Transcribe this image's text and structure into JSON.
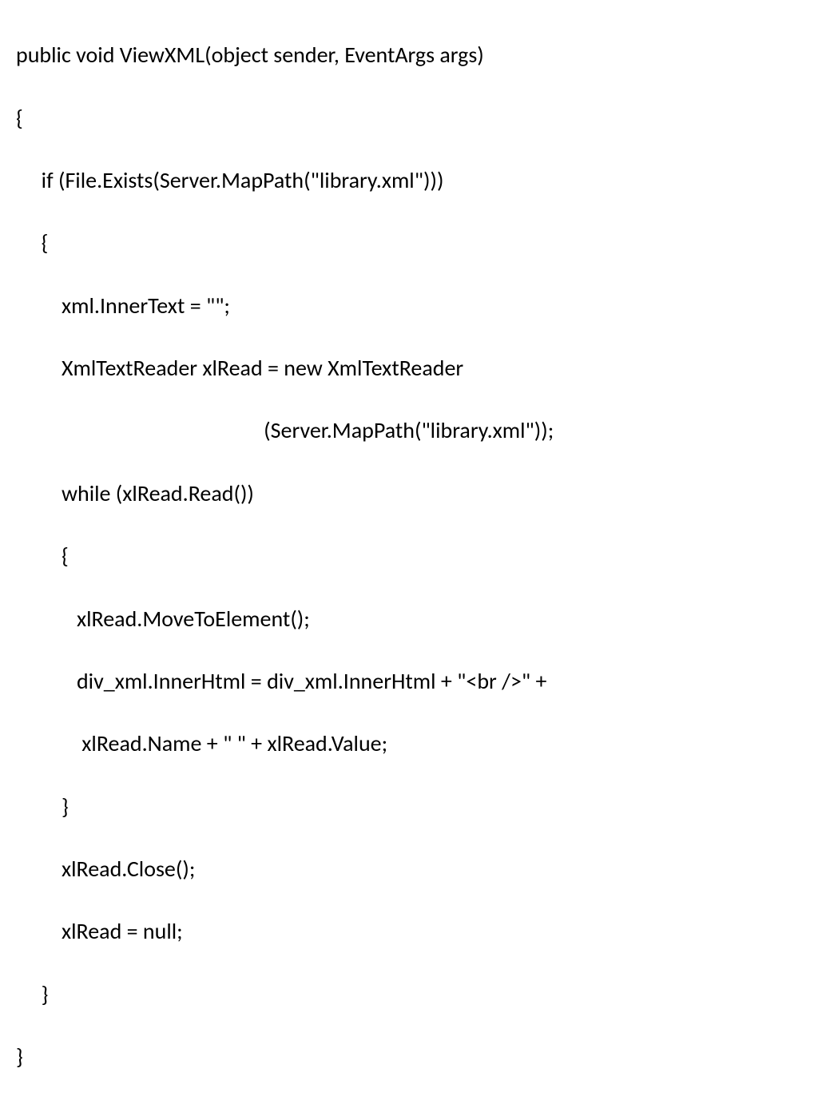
{
  "code": {
    "l1": "public void ViewXML(object sender, EventArgs args)",
    "l2": "{",
    "l3": "     if (File.Exists(Server.MapPath(\"library.xml\")))",
    "l4": "     {",
    "l5": "         xml.InnerText = \"\";",
    "l6": "         XmlTextReader xlRead = new XmlTextReader",
    "l7": "                                                 (Server.MapPath(\"library.xml\"));",
    "l8": "         while (xlRead.Read())",
    "l9": "         {",
    "l10": "            xlRead.MoveToElement();",
    "l11": "            div_xml.InnerHtml = div_xml.InnerHtml + \"<br />\" +",
    "l12": "             xlRead.Name + \" \" + xlRead.Value;",
    "l13": "         }",
    "l14": "         xlRead.Close();",
    "l15": "         xlRead = null;",
    "l16": "     }",
    "l17": "}"
  }
}
